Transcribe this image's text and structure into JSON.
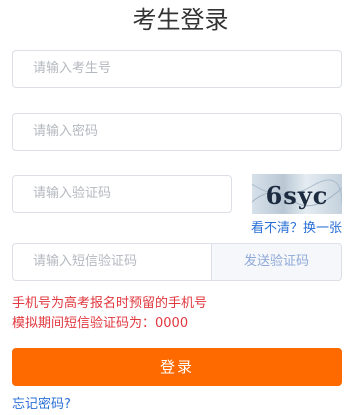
{
  "page": {
    "title": "考生登录"
  },
  "form": {
    "username_placeholder": "请输入考生号",
    "password_placeholder": "请输入密码",
    "captcha_placeholder": "请输入验证码",
    "sms_placeholder": "请输入短信验证码",
    "send_sms_label": "发送验证码",
    "refresh_captcha_label": "看不清？换一张",
    "captcha_code": "6syc"
  },
  "hints": {
    "line1": "手机号为高考报名时预留的手机号",
    "line2": "模拟期间短信验证码为：0000"
  },
  "actions": {
    "login_label": "登录",
    "forgot_password_label": "忘记密码?"
  },
  "colors": {
    "primary": "#ff6a00",
    "link": "#2a6fd6",
    "warning": "#e0383e"
  }
}
